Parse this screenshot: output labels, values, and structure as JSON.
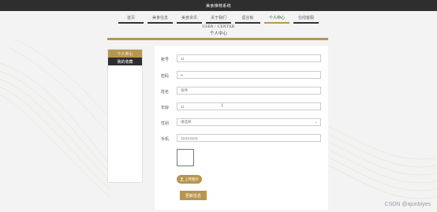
{
  "header": {
    "title": "美食推荐系统"
  },
  "nav": {
    "items": [
      {
        "label": "首页"
      },
      {
        "label": "美食信息"
      },
      {
        "label": "美食资讯"
      },
      {
        "label": "关于我们"
      },
      {
        "label": "留言板"
      },
      {
        "label": "个人中心"
      },
      {
        "label": "在线客服"
      }
    ],
    "active_index": 5
  },
  "section": {
    "title_en": "USER / CENTER",
    "title_cn": "个人中心"
  },
  "sidebar": {
    "items": [
      {
        "label": "个人中心"
      },
      {
        "label": "我的收藏"
      }
    ]
  },
  "form": {
    "account": {
      "label": "账号",
      "value": "11"
    },
    "password": {
      "label": "密码",
      "value": "••"
    },
    "name": {
      "label": "姓名",
      "value": "张伟"
    },
    "age": {
      "label": "年龄",
      "value": "11"
    },
    "gender": {
      "label": "性别",
      "value": "请选择"
    },
    "phone": {
      "label": "手机",
      "value": "1111111111"
    }
  },
  "upload_label": "上传图片",
  "save_label": "更新信息",
  "watermark": "CSDN @ajunbiyes",
  "colors": {
    "accent": "#b8964f",
    "dark": "#2e2e2e"
  },
  "icons": [
    "upload-icon",
    "chevron-down-icon",
    "text-cursor-icon"
  ]
}
